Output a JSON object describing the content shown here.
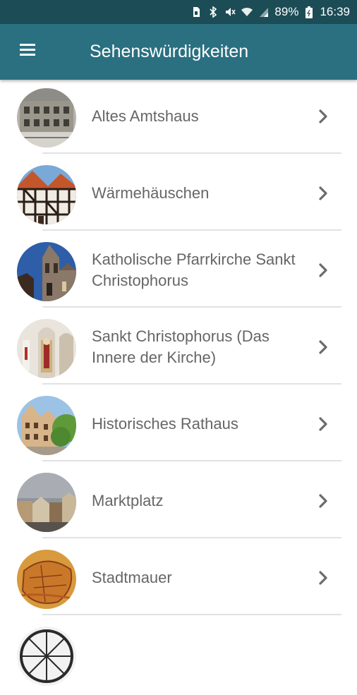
{
  "status_bar": {
    "battery": "89%",
    "time": "16:39",
    "icons": [
      "sim-icon",
      "bluetooth-icon",
      "mute-icon",
      "wifi-icon",
      "signal-icon",
      "battery-icon"
    ]
  },
  "app_bar": {
    "title": "Sehenswürdigkeiten",
    "menu_icon": "hamburger-menu-icon"
  },
  "colors": {
    "status_bar": "#1c4d57",
    "app_bar": "#2a7080",
    "label_text": "#666666",
    "chevron": "#6b6b6b",
    "divider": "#e2e2e2"
  },
  "list": {
    "items": [
      {
        "label": "Altes Amtshaus",
        "thumbnail": "old-building-photo"
      },
      {
        "label": "Wärmehäuschen",
        "thumbnail": "half-timbered-house-photo"
      },
      {
        "label": "Katholische Pfarrkirche Sankt Christophorus",
        "thumbnail": "church-tower-photo"
      },
      {
        "label": "Sankt Christophorus (Das Innere der Kirche)",
        "thumbnail": "church-interior-photo"
      },
      {
        "label": "Historisches Rathaus",
        "thumbnail": "town-hall-photo"
      },
      {
        "label": "Marktplatz",
        "thumbnail": "market-square-photo"
      },
      {
        "label": "Stadtmauer",
        "thumbnail": "city-map-photo"
      },
      {
        "label": "",
        "thumbnail": "wheel-photo"
      }
    ],
    "chevron_icon": "chevron-right-icon"
  }
}
